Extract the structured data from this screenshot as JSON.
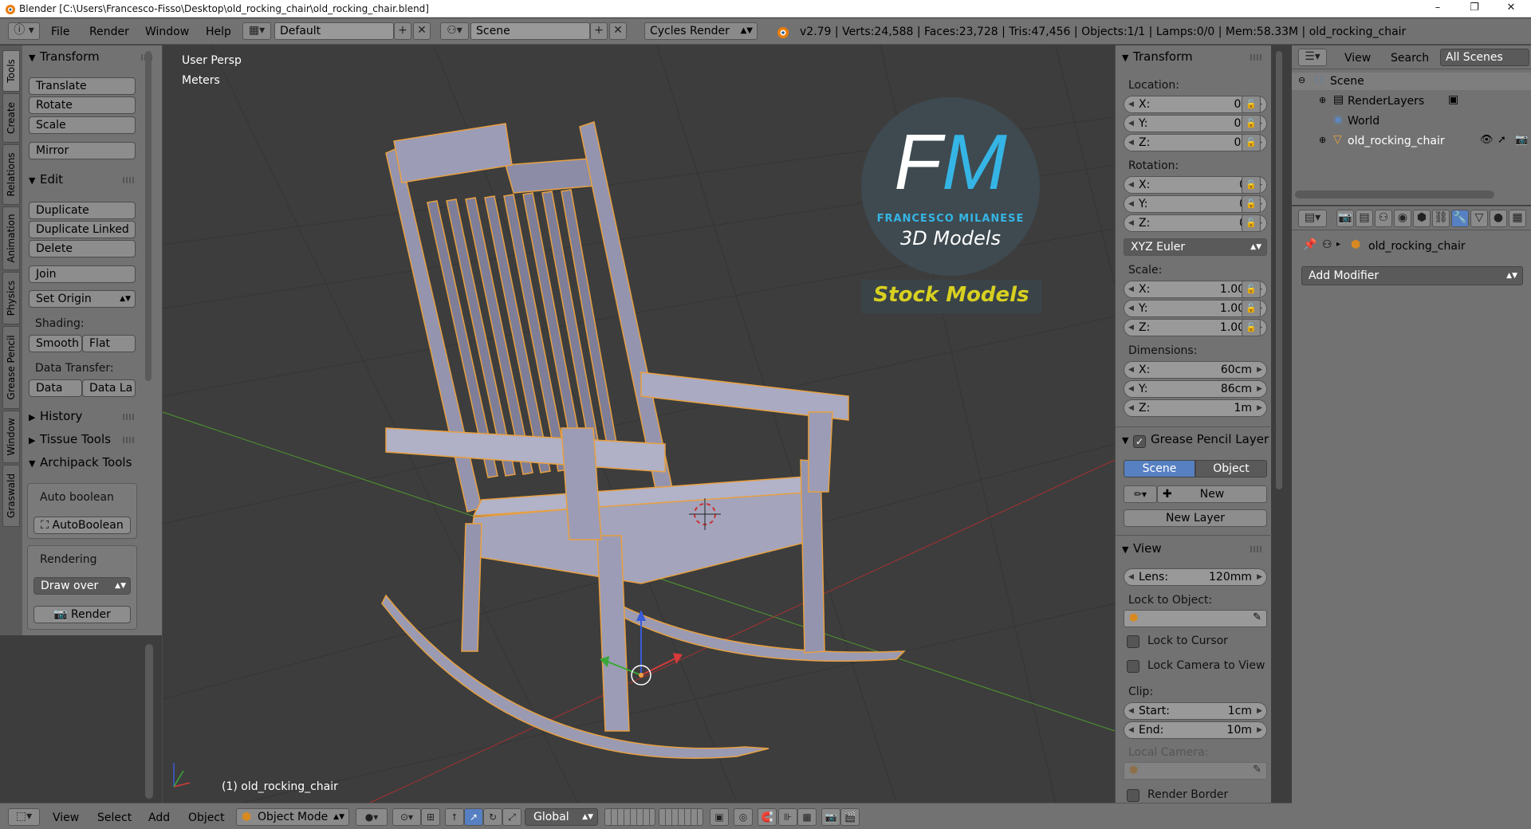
{
  "window": {
    "title": "Blender [C:\\Users\\Francesco-Fisso\\Desktop\\old_rocking_chair\\old_rocking_chair.blend]",
    "minimize": "–",
    "maximize": "❐",
    "close": "✕"
  },
  "infobar": {
    "menus": [
      "File",
      "Render",
      "Window",
      "Help"
    ],
    "screen_layout": "Default",
    "scene": "Scene",
    "render_engine": "Cycles Render",
    "stats": "v2.79 | Verts:24,588 | Faces:23,728 | Tris:47,456 | Objects:1/1 | Lamps:0/0 | Mem:58.33M | old_rocking_chair"
  },
  "left_tabs": [
    "Tools",
    "Create",
    "Relations",
    "Animation",
    "Physics",
    "Grease Pencil",
    "Window",
    "Graswald"
  ],
  "toolshelf": {
    "transform_header": "Transform",
    "translate": "Translate",
    "rotate": "Rotate",
    "scale": "Scale",
    "mirror": "Mirror",
    "edit_header": "Edit",
    "duplicate": "Duplicate",
    "duplicate_linked": "Duplicate Linked",
    "delete": "Delete",
    "join": "Join",
    "set_origin": "Set Origin",
    "shading_label": "Shading:",
    "smooth": "Smooth",
    "flat": "Flat",
    "data_transfer_label": "Data Transfer:",
    "data": "Data",
    "data_la": "Data La",
    "history": "History",
    "tissue_tools": "Tissue Tools",
    "archipack_tools": "Archipack Tools",
    "auto_boolean_label": "Auto boolean",
    "autoboolean_btn": "AutoBoolean",
    "rendering_label": "Rendering",
    "draw_over": "Draw over",
    "render": "Render"
  },
  "viewport": {
    "view_name": "User Persp",
    "units": "Meters",
    "object_label": "(1) old_rocking_chair",
    "logo_letters": "FM",
    "logo_name": "FRANCESCO MILANESE",
    "logo_sub": "3D Models",
    "logo_stock": "Stock Models"
  },
  "npanel": {
    "transform_header": "Transform",
    "location_label": "Location:",
    "loc": [
      {
        "k": "X:",
        "v": "0m"
      },
      {
        "k": "Y:",
        "v": "0m"
      },
      {
        "k": "Z:",
        "v": "0m"
      }
    ],
    "rotation_label": "Rotation:",
    "rot": [
      {
        "k": "X:",
        "v": "0°"
      },
      {
        "k": "Y:",
        "v": "0°"
      },
      {
        "k": "Z:",
        "v": "0°"
      }
    ],
    "rotation_mode": "XYZ Euler",
    "scale_label": "Scale:",
    "scale": [
      {
        "k": "X:",
        "v": "1.000"
      },
      {
        "k": "Y:",
        "v": "1.000"
      },
      {
        "k": "Z:",
        "v": "1.000"
      }
    ],
    "dimensions_label": "Dimensions:",
    "dim": [
      {
        "k": "X:",
        "v": "60cm"
      },
      {
        "k": "Y:",
        "v": "86cm"
      },
      {
        "k": "Z:",
        "v": "1m"
      }
    ],
    "gp_header": "Grease Pencil Layer",
    "gp_scene": "Scene",
    "gp_object": "Object",
    "gp_new": "New",
    "gp_new_layer": "New Layer",
    "view_header": "View",
    "lens_k": "Lens:",
    "lens_v": "120mm",
    "lock_to_object": "Lock to Object:",
    "lock_to_cursor": "Lock to Cursor",
    "lock_camera": "Lock Camera to View",
    "clip_label": "Clip:",
    "clip_start_k": "Start:",
    "clip_start_v": "1cm",
    "clip_end_k": "End:",
    "clip_end_v": "10m",
    "local_camera": "Local Camera:",
    "render_border": "Render Border"
  },
  "outliner": {
    "view": "View",
    "search": "Search",
    "all_scenes": "All Scenes",
    "scene": "Scene",
    "render_layers": "RenderLayers",
    "world": "World",
    "object": "old_rocking_chair"
  },
  "properties": {
    "object_name": "old_rocking_chair",
    "add_modifier": "Add Modifier"
  },
  "bottombar": {
    "menus": [
      "View",
      "Select",
      "Add",
      "Object"
    ],
    "mode": "Object Mode",
    "orientation": "Global"
  },
  "colors": {
    "panel": "#727272",
    "viewport": "#3d3d3d",
    "accent_blue": "#5680c2",
    "selection_outline": "#e8a040",
    "logo_yellow": "#d8d020"
  }
}
